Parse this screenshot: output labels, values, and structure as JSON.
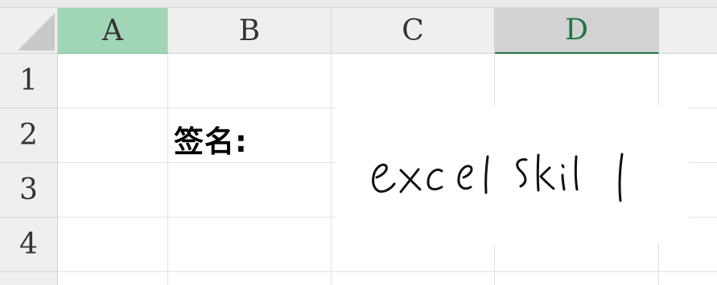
{
  "columns": [
    {
      "label": "A",
      "state": "selected"
    },
    {
      "label": "B",
      "state": "normal"
    },
    {
      "label": "C",
      "state": "normal"
    },
    {
      "label": "D",
      "state": "active"
    }
  ],
  "rows": [
    "1",
    "2",
    "3",
    "4"
  ],
  "cells": {
    "B2": "签名:"
  },
  "signature_image": {
    "text": "excel skill"
  },
  "colors": {
    "selected_column_fill": "#a0d6b7",
    "active_column_text": "#217346",
    "header_fill": "#efefef"
  }
}
